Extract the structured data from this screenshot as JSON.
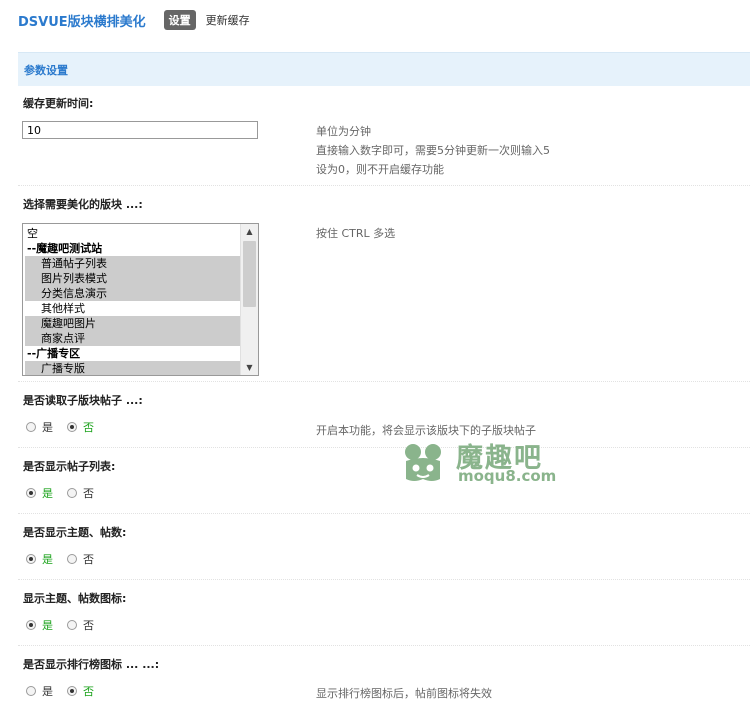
{
  "header": {
    "app_title": "DSVUE版块横排美化",
    "tabs": [
      {
        "label": "设置",
        "active": true
      },
      {
        "label": "更新缓存",
        "active": false
      }
    ]
  },
  "section": {
    "title": "参数设置"
  },
  "cache": {
    "label": "缓存更新时间:",
    "value": "10",
    "tips": [
      "单位为分钟",
      "直接输入数字即可，需要5分钟更新一次则输入5",
      "设为0，则不开启缓存功能"
    ]
  },
  "forums": {
    "label": "选择需要美化的版块 ...:",
    "tip": "按住 CTRL 多选",
    "options": [
      {
        "text": "空",
        "selected": false,
        "group": false,
        "indent": false
      },
      {
        "text": "--魔趣吧测试站",
        "selected": false,
        "group": true,
        "indent": false
      },
      {
        "text": "普通帖子列表",
        "selected": true,
        "group": false,
        "indent": true
      },
      {
        "text": "图片列表模式",
        "selected": true,
        "group": false,
        "indent": true
      },
      {
        "text": "分类信息演示",
        "selected": true,
        "group": false,
        "indent": true
      },
      {
        "text": "其他样式",
        "selected": false,
        "group": false,
        "indent": true
      },
      {
        "text": "魔趣吧图片",
        "selected": true,
        "group": false,
        "indent": true
      },
      {
        "text": "商家点评",
        "selected": true,
        "group": false,
        "indent": true
      },
      {
        "text": "--广播专区",
        "selected": false,
        "group": true,
        "indent": false
      },
      {
        "text": "广播专版",
        "selected": true,
        "group": false,
        "indent": true
      }
    ]
  },
  "subforum": {
    "label": "是否读取子版块帖子 ...:",
    "yes": "是",
    "no": "否",
    "selected": "no",
    "tip": "开启本功能，将会显示该版块下的子版块帖子"
  },
  "show_list": {
    "label": "是否显示帖子列表:",
    "yes": "是",
    "no": "否",
    "selected": "yes"
  },
  "show_count": {
    "label": "是否显示主题、帖数:",
    "yes": "是",
    "no": "否",
    "selected": "yes"
  },
  "count_icon": {
    "label": "显示主题、帖数图标:",
    "yes": "是",
    "no": "否",
    "selected": "yes"
  },
  "rank_icon": {
    "label": "是否显示排行榜图标 ... ...:",
    "yes": "是",
    "no": "否",
    "selected": "no",
    "tip": "显示排行榜图标后，帖前图标将失效"
  },
  "watermark": {
    "cn": "魔趣吧",
    "en": "moqu8.com"
  },
  "colors": {
    "accent": "#2b7acd",
    "section_bg": "#e6f2fb",
    "yes_green": "#1aa21a",
    "selected_bg": "#cccccc",
    "watermark": "#8ab48c"
  }
}
